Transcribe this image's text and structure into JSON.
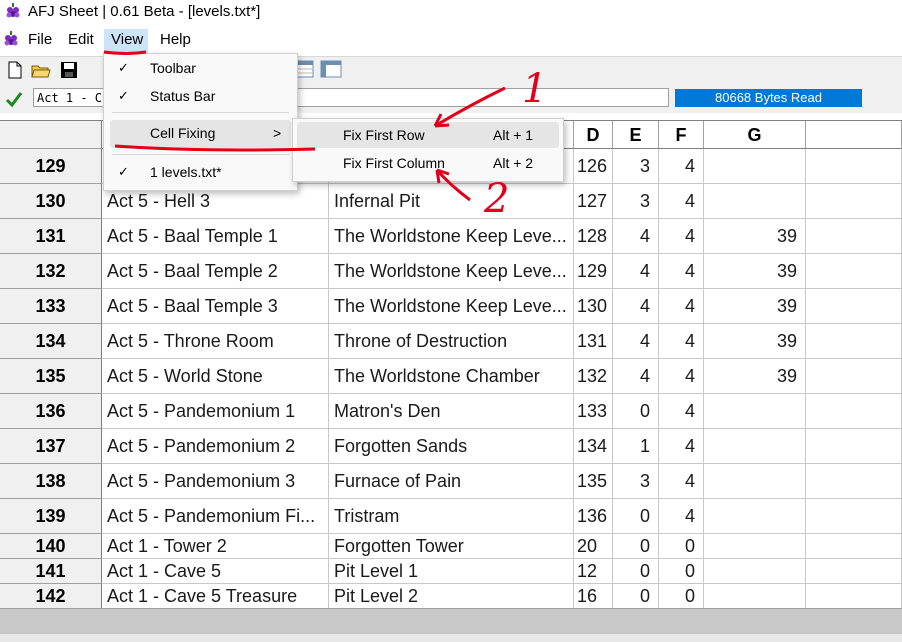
{
  "window": {
    "title": "AFJ Sheet | 0.61 Beta - [levels.txt*]"
  },
  "menubar": {
    "items": [
      "File",
      "Edit",
      "View",
      "Help"
    ]
  },
  "toolbar": {
    "buttons": [
      "new-file-icon",
      "open-folder-icon",
      "save-icon"
    ]
  },
  "formula": {
    "cell_value": "Act 1 - C",
    "status": "80668 Bytes Read"
  },
  "grid": {
    "columns": [
      "",
      "",
      "C",
      "D",
      "E",
      "F",
      "G"
    ],
    "rows": [
      {
        "id": "129",
        "a": "",
        "b": "",
        "c": "126",
        "d": "3",
        "e": "4",
        "f": ""
      },
      {
        "id": "130",
        "a": "Act 5 - Hell 3",
        "b": "Infernal Pit",
        "c": "127",
        "d": "3",
        "e": "4",
        "f": ""
      },
      {
        "id": "131",
        "a": "Act 5 - Baal Temple 1",
        "b": "The Worldstone Keep Leve...",
        "c": "128",
        "d": "4",
        "e": "4",
        "f": "39"
      },
      {
        "id": "132",
        "a": "Act 5 - Baal Temple 2",
        "b": "The Worldstone Keep Leve...",
        "c": "129",
        "d": "4",
        "e": "4",
        "f": "39"
      },
      {
        "id": "133",
        "a": "Act 5 - Baal Temple 3",
        "b": "The Worldstone Keep Leve...",
        "c": "130",
        "d": "4",
        "e": "4",
        "f": "39"
      },
      {
        "id": "134",
        "a": "Act 5 - Throne Room",
        "b": "Throne of Destruction",
        "c": "131",
        "d": "4",
        "e": "4",
        "f": "39"
      },
      {
        "id": "135",
        "a": "Act 5 - World Stone",
        "b": "The Worldstone Chamber",
        "c": "132",
        "d": "4",
        "e": "4",
        "f": "39"
      },
      {
        "id": "136",
        "a": "Act 5 - Pandemonium 1",
        "b": "Matron's Den",
        "c": "133",
        "d": "0",
        "e": "4",
        "f": ""
      },
      {
        "id": "137",
        "a": "Act 5 - Pandemonium 2",
        "b": "Forgotten Sands",
        "c": "134",
        "d": "1",
        "e": "4",
        "f": ""
      },
      {
        "id": "138",
        "a": "Act 5 - Pandemonium 3",
        "b": "Furnace of Pain",
        "c": "135",
        "d": "3",
        "e": "4",
        "f": ""
      },
      {
        "id": "139",
        "a": "Act 5 - Pandemonium Fi...",
        "b": "Tristram",
        "c": "136",
        "d": "0",
        "e": "4",
        "f": ""
      },
      {
        "id": "140",
        "a": "Act 1 - Tower 2",
        "b": "Forgotten Tower",
        "c": "20",
        "d": "0",
        "e": "0",
        "f": ""
      },
      {
        "id": "141",
        "a": "Act 1 - Cave 5",
        "b": "Pit Level 1",
        "c": "12",
        "d": "0",
        "e": "0",
        "f": ""
      },
      {
        "id": "142",
        "a": "Act 1 - Cave 5 Treasure",
        "b": "Pit Level 2",
        "c": "16",
        "d": "0",
        "e": "0",
        "f": ""
      }
    ]
  },
  "view_menu": {
    "items": [
      {
        "label": "Toolbar",
        "check": "✓"
      },
      {
        "label": "Status Bar",
        "check": "✓"
      },
      {
        "label": "Cell Fixing",
        "arrow": ">"
      },
      {
        "label": "1 levels.txt*",
        "check": "✓"
      }
    ]
  },
  "submenu": {
    "items": [
      {
        "label": "Fix First Row",
        "shortcut": "Alt + 1"
      },
      {
        "label": "Fix First Column",
        "shortcut": "Alt + 2"
      }
    ]
  },
  "annotations": {
    "one": "1",
    "two": "2"
  },
  "colors": {
    "accent": "#0078d7",
    "annotation": "#e0001a"
  }
}
